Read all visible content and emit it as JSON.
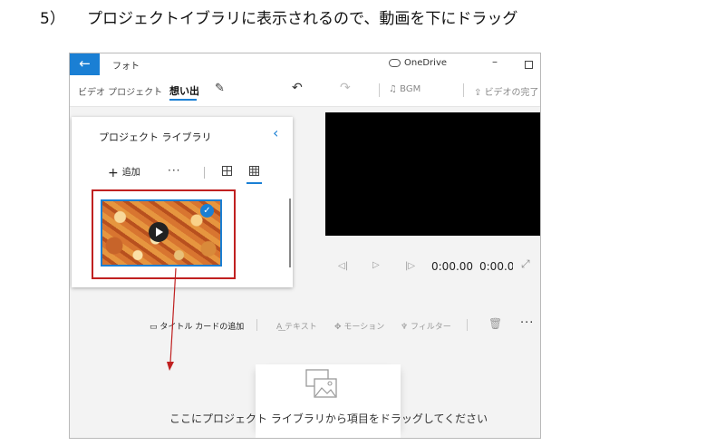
{
  "instruction": {
    "step": "5）",
    "text": "プロジェクトイブラリに表示されるので、動画を下にドラッグ"
  },
  "window": {
    "title": "フォト",
    "onedrive": "OneDrive",
    "back_icon": "back-arrow-icon",
    "minimize": "–"
  },
  "toolbar": {
    "breadcrumb_parent": "ビデオ プロジェクト",
    "breadcrumb_current": "想い出",
    "bgm": "BGM",
    "finish": "ビデオの完了"
  },
  "library": {
    "title": "プロジェクト ライブラリ",
    "add": "追加",
    "more": "···"
  },
  "player": {
    "position": "0:00.00",
    "duration": "0:00.00"
  },
  "storyboard": {
    "title_card": "タイトル カードの追加",
    "text": "テキスト",
    "motion": "モーション",
    "filter": "フィルター",
    "more": "···",
    "drop_hint": "ここにプロジェクト ライブラリから項目をドラッグしてください"
  },
  "colors": {
    "accent": "#1a7fd4",
    "annotation": "#c02020",
    "preview_bg": "#000000"
  }
}
